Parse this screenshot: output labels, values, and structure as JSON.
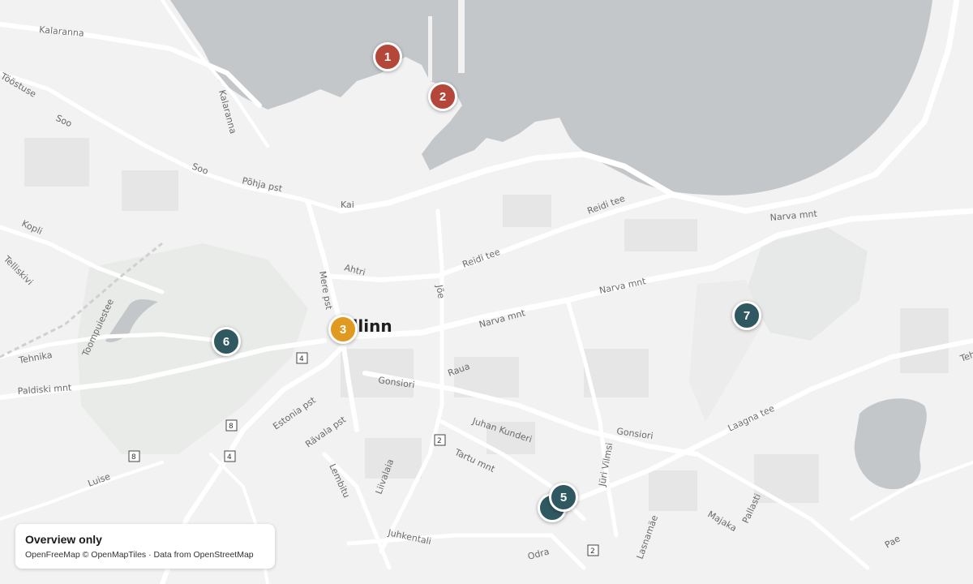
{
  "map": {
    "city_label": "Tallinn",
    "roads": [
      "Kalaranna",
      "Tööstuse",
      "Soo",
      "Soo",
      "Põhja pst",
      "Kai",
      "Kopli",
      "Telliskivi",
      "Toompuiestee",
      "Tehnika",
      "Paldiski mnt",
      "Luise",
      "Mere pst",
      "Ahtri",
      "Jõe",
      "Reidi tee",
      "Reidi tee",
      "Narva mnt",
      "Narva mnt",
      "Narva mnt",
      "Raua",
      "Gonsiori",
      "Gonsiori",
      "Estonia pst",
      "Rävala pst",
      "Lembitu",
      "Liivalaia",
      "Juhan Kunderi",
      "Tartu mnt",
      "Jüri Vilmsi",
      "Juhkentali",
      "Odra",
      "Lasnamäe",
      "Majaka",
      "Pallasti",
      "Laagna tee",
      "Pae",
      "Tehnika",
      "Kalaranna"
    ],
    "shields": [
      "4",
      "8",
      "8",
      "4",
      "2",
      "2"
    ]
  },
  "markers": [
    {
      "label": "1",
      "color": "#b5473a"
    },
    {
      "label": "2",
      "color": "#b5473a"
    },
    {
      "label": "3",
      "color": "#e09a22"
    },
    {
      "label": "6",
      "color": "#2f5860"
    },
    {
      "label": "7",
      "color": "#2f5860"
    },
    {
      "label": "",
      "color": "#2f5860"
    },
    {
      "label": "5",
      "color": "#2f5860"
    }
  ],
  "info": {
    "title": "Overview only",
    "attribution": "OpenFreeMap © OpenMapTiles · Data from OpenStreetMap"
  }
}
